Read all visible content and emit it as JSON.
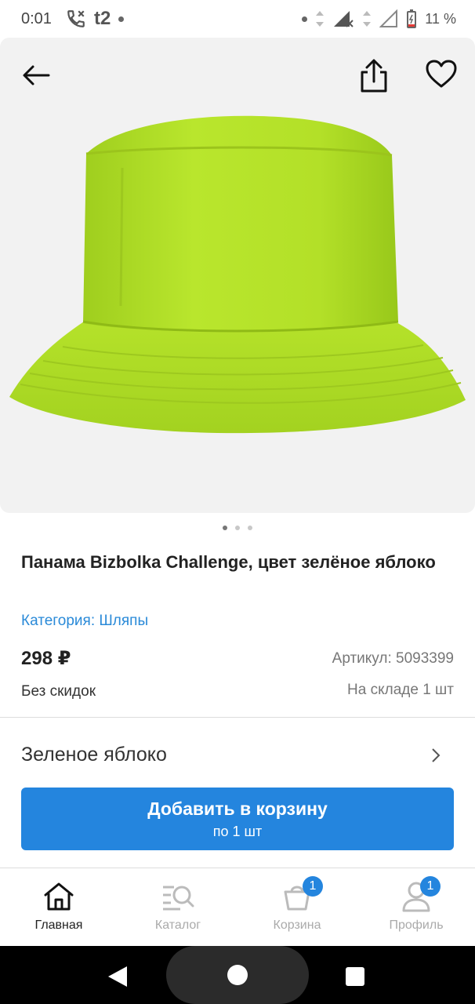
{
  "status": {
    "time": "0:01",
    "carrier": "t2",
    "battery": "11 %"
  },
  "product": {
    "title": "Панама Bizbolka Challenge, цвет зелёное яблоко",
    "category": "Категория: Шляпы",
    "price": "298 ₽",
    "discount": "Без скидок",
    "sku": "Артикул: 5093399",
    "stock": "На складе 1 шт",
    "variant": "Зеленое яблоко",
    "hat_color": "#b8e62c"
  },
  "gallery": {
    "pages": 3,
    "active_page": 1
  },
  "cart_button": {
    "label": "Добавить в корзину",
    "sub": "по 1 шт",
    "color": "#2485de"
  },
  "tabs": [
    {
      "label": "Главная",
      "icon": "home-icon",
      "active": true
    },
    {
      "label": "Каталог",
      "icon": "catalog-search-icon"
    },
    {
      "label": "Корзина",
      "icon": "cart-bag-icon",
      "badge": "1"
    },
    {
      "label": "Профиль",
      "icon": "profile-icon",
      "badge": "1"
    }
  ]
}
